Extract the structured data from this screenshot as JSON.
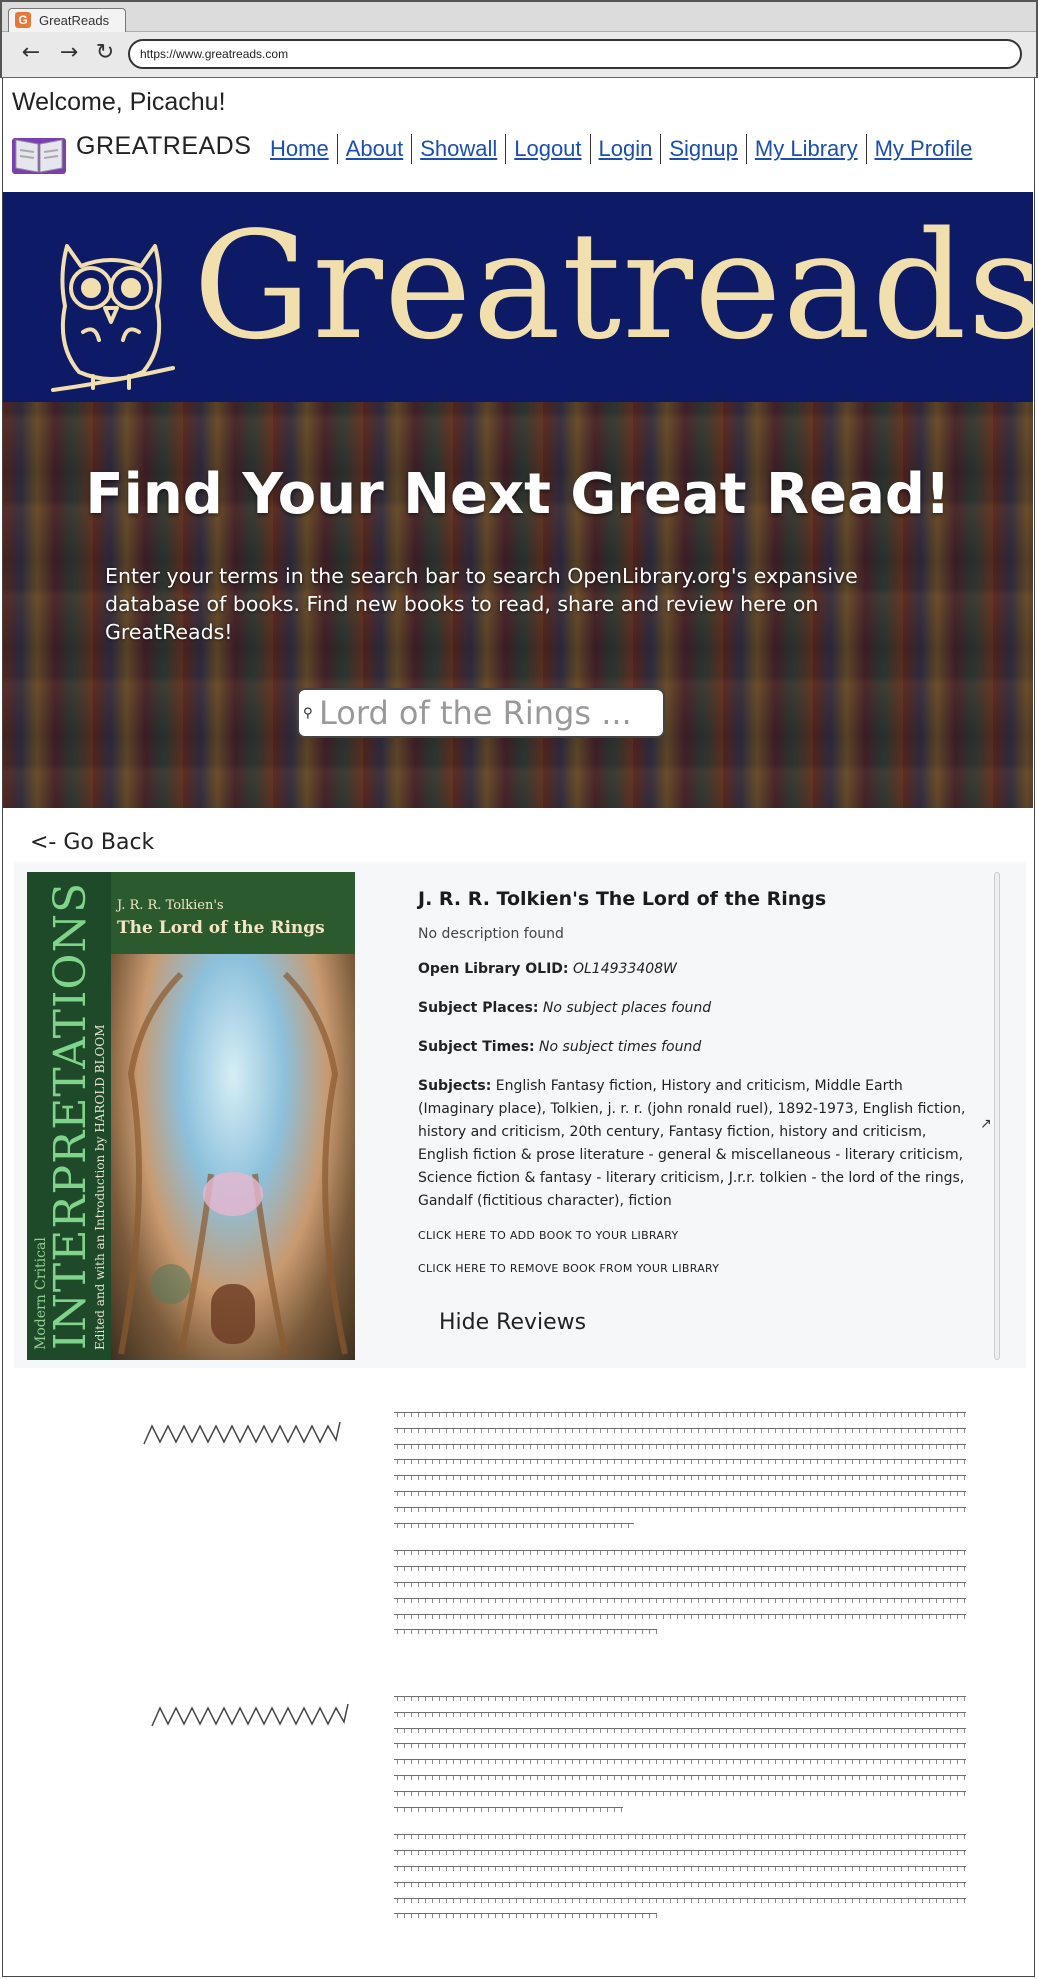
{
  "browser": {
    "tab_title": "GreatReads",
    "favicon_letter": "G",
    "url": "https://www.greatreads.com",
    "back_icon": "←",
    "forward_icon": "→",
    "reload_icon": "↻"
  },
  "header": {
    "welcome": "Welcome, Picachu!",
    "brand": "GREATREADS",
    "nav": [
      "Home",
      "About",
      "Showall",
      "Logout",
      "Login",
      "Signup",
      "My Library",
      "My Profile"
    ]
  },
  "banner": {
    "title": "Greatreads",
    "brand_color": "#0d1a66",
    "title_color": "#f2dfae"
  },
  "hero": {
    "title": "Find Your Next Great Read!",
    "text": "Enter your terms in the search bar to search OpenLibrary.org's expansive database of books.  Find new books to read, share and review here on GreatReads!",
    "search_placeholder": "Lord of the Rings ...",
    "search_icon": "🔍"
  },
  "go_back": "<- Go Back",
  "book": {
    "cover": {
      "author_line": "J. R. R. Tolkien's",
      "title_line": "The Lord of the Rings",
      "series_small": "Modern Critical",
      "series_big": "INTERPRETATIONS",
      "editor": "Edited and with an Introduction by HAROLD BLOOM"
    },
    "title": "J. R. R. Tolkien's The Lord of the Rings",
    "description": "No description found",
    "olid_label": "Open Library OLID:",
    "olid_value": "OL14933408W",
    "places_label": "Subject Places:",
    "places_value": "No subject places found",
    "times_label": "Subject Times:",
    "times_value": "No subject times found",
    "subjects_label": "Subjects:",
    "subjects_value": "English Fantasy fiction, History and criticism, Middle Earth (Imaginary place), Tolkien, j. r. r. (john ronald ruel), 1892-1973, English fiction, history and criticism, 20th century, Fantasy fiction, history and criticism, English fiction & prose literature - general & miscellaneous - literary criticism, Science fiction & fantasy - literary criticism, J.r.r. tolkien - the lord of the rings, Gandalf (fictitious character), fiction",
    "add_link": "CLICK HERE TO ADD BOOK TO YOUR LIBRARY",
    "remove_link": "CLICK HERE TO REMOVE BOOK FROM YOUR LIBRARY",
    "hide_reviews": "Hide Reviews"
  }
}
